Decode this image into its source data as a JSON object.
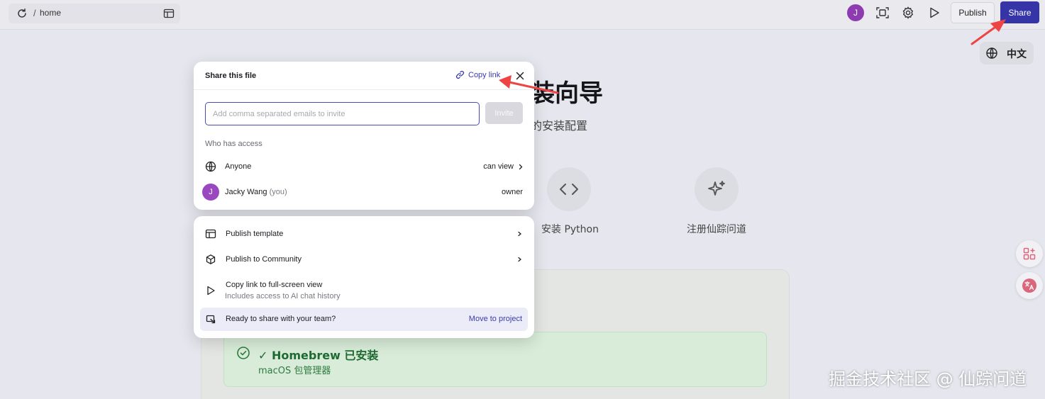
{
  "topbar": {
    "path_separator": "/",
    "path": "home",
    "avatar_initial": "J",
    "publish_label": "Publish",
    "share_label": "Share"
  },
  "language_toggle": {
    "label": "中文"
  },
  "background_page": {
    "title": "装向导",
    "subtitle": "的安装配置",
    "steps": [
      {
        "label": "安装 Python",
        "icon": "code-icon"
      },
      {
        "label": "注册仙踪问道",
        "icon": "sparkle-icon"
      }
    ],
    "status_card": {
      "title": "✓ Homebrew 已安装",
      "subtitle": "macOS 包管理器"
    }
  },
  "share_popover": {
    "title": "Share this file",
    "copy_link_label": "Copy link",
    "email_placeholder": "Add comma separated emails to invite",
    "email_value": "",
    "invite_label": "Invite",
    "who_has_access_label": "Who has access",
    "access": [
      {
        "name": "Anyone",
        "role": "can view",
        "icon": "globe-icon"
      },
      {
        "name": "Jacky Wang",
        "suffix": "(you)",
        "role": "owner",
        "avatar_initial": "J"
      }
    ]
  },
  "publish_popover": {
    "items": [
      {
        "label": "Publish template",
        "icon": "layout-icon"
      },
      {
        "label": "Publish to Community",
        "icon": "box-icon"
      },
      {
        "label": "Copy link to full-screen view",
        "sublabel": "Includes access to AI chat history",
        "icon": "play-icon"
      }
    ],
    "team_prompt": {
      "label": "Ready to share with your team?",
      "action": "Move to project"
    }
  },
  "watermark": "掘金技术社区 @ 仙踪问道",
  "colors": {
    "accent": "#3535a8",
    "link": "#3a3ab0",
    "avatar": "#8e3bb2",
    "annotation_arrow": "#ee4444",
    "success": "#1f6b33"
  }
}
